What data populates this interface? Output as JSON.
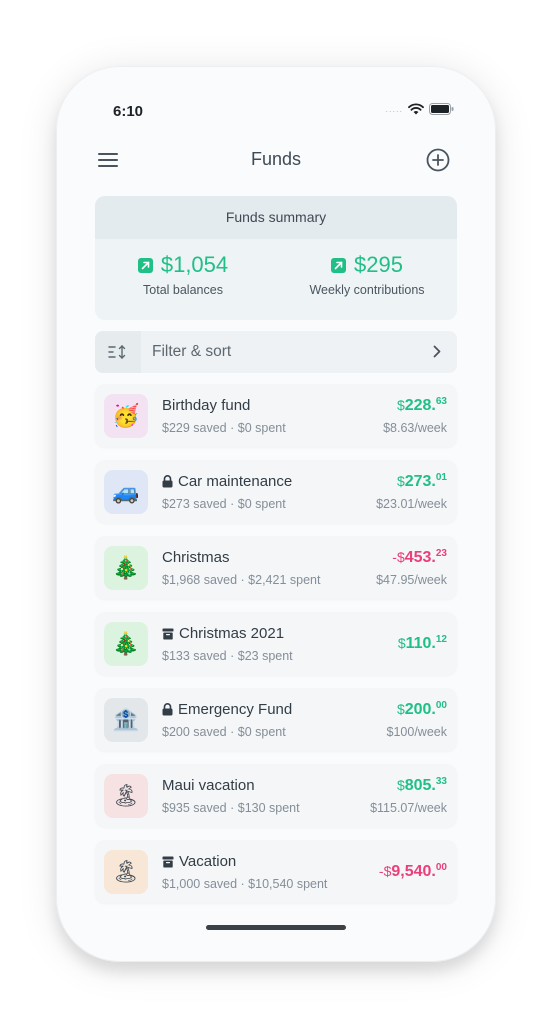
{
  "status": {
    "time": "6:10",
    "signal": "....."
  },
  "nav": {
    "title": "Funds",
    "menu_icon": "hamburger-menu-icon",
    "add_icon": "plus-circle-icon"
  },
  "summary": {
    "header": "Funds summary",
    "total_balances": {
      "value": "$1,054",
      "label": "Total balances"
    },
    "weekly_contributions": {
      "value": "$295",
      "label": "Weekly contributions"
    }
  },
  "filter": {
    "label": "Filter & sort"
  },
  "colors": {
    "positive": "#1fbf86",
    "negative": "#ea3f78"
  },
  "funds": [
    {
      "emoji": "🥳",
      "emoji_bg": "#f3e2f2",
      "name": "Birthday fund",
      "badge": "",
      "meta": "$229 saved · $0 spent",
      "sign": "",
      "amount_whole": "228.",
      "amount_cents": "63",
      "weekly": "$8.63/week",
      "negative": false
    },
    {
      "emoji": "🚙",
      "emoji_bg": "#dfe7f6",
      "name": "Car maintenance",
      "badge": "lock",
      "meta": "$273 saved · $0 spent",
      "sign": "",
      "amount_whole": "273.",
      "amount_cents": "01",
      "weekly": "$23.01/week",
      "negative": false
    },
    {
      "emoji": "🎄",
      "emoji_bg": "#dcf3df",
      "name": "Christmas",
      "badge": "",
      "meta": "$1,968 saved · $2,421 spent",
      "sign": "-",
      "amount_whole": "453.",
      "amount_cents": "23",
      "weekly": "$47.95/week",
      "negative": true
    },
    {
      "emoji": "🎄",
      "emoji_bg": "#dcf3df",
      "name": "Christmas 2021",
      "badge": "archive",
      "meta": "$133 saved · $23 spent",
      "sign": "",
      "amount_whole": "110.",
      "amount_cents": "12",
      "weekly": "",
      "negative": false
    },
    {
      "emoji": "🏦",
      "emoji_bg": "#e4e7ea",
      "name": "Emergency Fund",
      "badge": "lock",
      "meta": "$200 saved · $0 spent",
      "sign": "",
      "amount_whole": "200.",
      "amount_cents": "00",
      "weekly": "$100/week",
      "negative": false
    },
    {
      "emoji": "🏝",
      "emoji_bg": "#f7e2e3",
      "name": "Maui vacation",
      "badge": "",
      "meta": "$935 saved · $130 spent",
      "sign": "",
      "amount_whole": "805.",
      "amount_cents": "33",
      "weekly": "$115.07/week",
      "negative": false
    },
    {
      "emoji": "🏝",
      "emoji_bg": "#f8e6d6",
      "name": "Vacation",
      "badge": "archive",
      "meta": "$1,000 saved · $10,540 spent",
      "sign": "-",
      "amount_whole": "9,540.",
      "amount_cents": "00",
      "weekly": "",
      "negative": true
    }
  ]
}
